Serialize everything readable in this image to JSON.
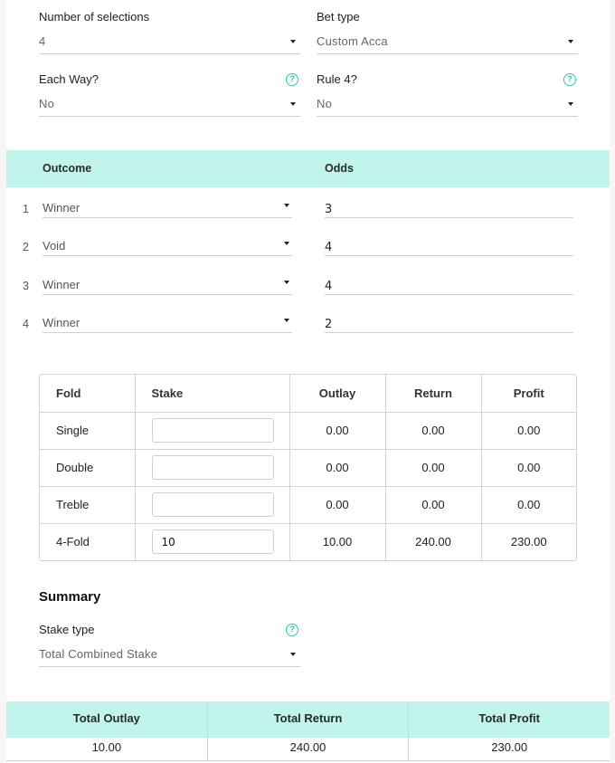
{
  "settings": {
    "num_selections": {
      "label": "Number of selections",
      "value": "4"
    },
    "bet_type": {
      "label": "Bet type",
      "value": "Custom Acca"
    },
    "each_way": {
      "label": "Each Way?",
      "value": "No"
    },
    "rule4": {
      "label": "Rule 4?",
      "value": "No"
    }
  },
  "selections": {
    "headers": {
      "outcome": "Outcome",
      "odds": "Odds"
    },
    "rows": [
      {
        "num": "1",
        "outcome": "Winner",
        "odds": "3"
      },
      {
        "num": "2",
        "outcome": "Void",
        "odds": "4"
      },
      {
        "num": "3",
        "outcome": "Winner",
        "odds": "4"
      },
      {
        "num": "4",
        "outcome": "Winner",
        "odds": "2"
      }
    ]
  },
  "folds": {
    "headers": {
      "fold": "Fold",
      "stake": "Stake",
      "outlay": "Outlay",
      "return": "Return",
      "profit": "Profit"
    },
    "rows": [
      {
        "fold": "Single",
        "stake": "",
        "outlay": "0.00",
        "return": "0.00",
        "profit": "0.00"
      },
      {
        "fold": "Double",
        "stake": "",
        "outlay": "0.00",
        "return": "0.00",
        "profit": "0.00"
      },
      {
        "fold": "Treble",
        "stake": "",
        "outlay": "0.00",
        "return": "0.00",
        "profit": "0.00"
      },
      {
        "fold": "4-Fold",
        "stake": "10",
        "outlay": "10.00",
        "return": "240.00",
        "profit": "230.00"
      }
    ]
  },
  "summary": {
    "title": "Summary",
    "stake_type": {
      "label": "Stake type",
      "value": "Total Combined Stake"
    },
    "totals": {
      "headers": {
        "outlay": "Total Outlay",
        "return": "Total Return",
        "profit": "Total Profit"
      },
      "values": {
        "outlay": "10.00",
        "return": "240.00",
        "profit": "230.00"
      }
    }
  },
  "icons": {
    "help": "?"
  },
  "colors": {
    "accent": "#2fc59f",
    "band": "#c1f4ea"
  }
}
